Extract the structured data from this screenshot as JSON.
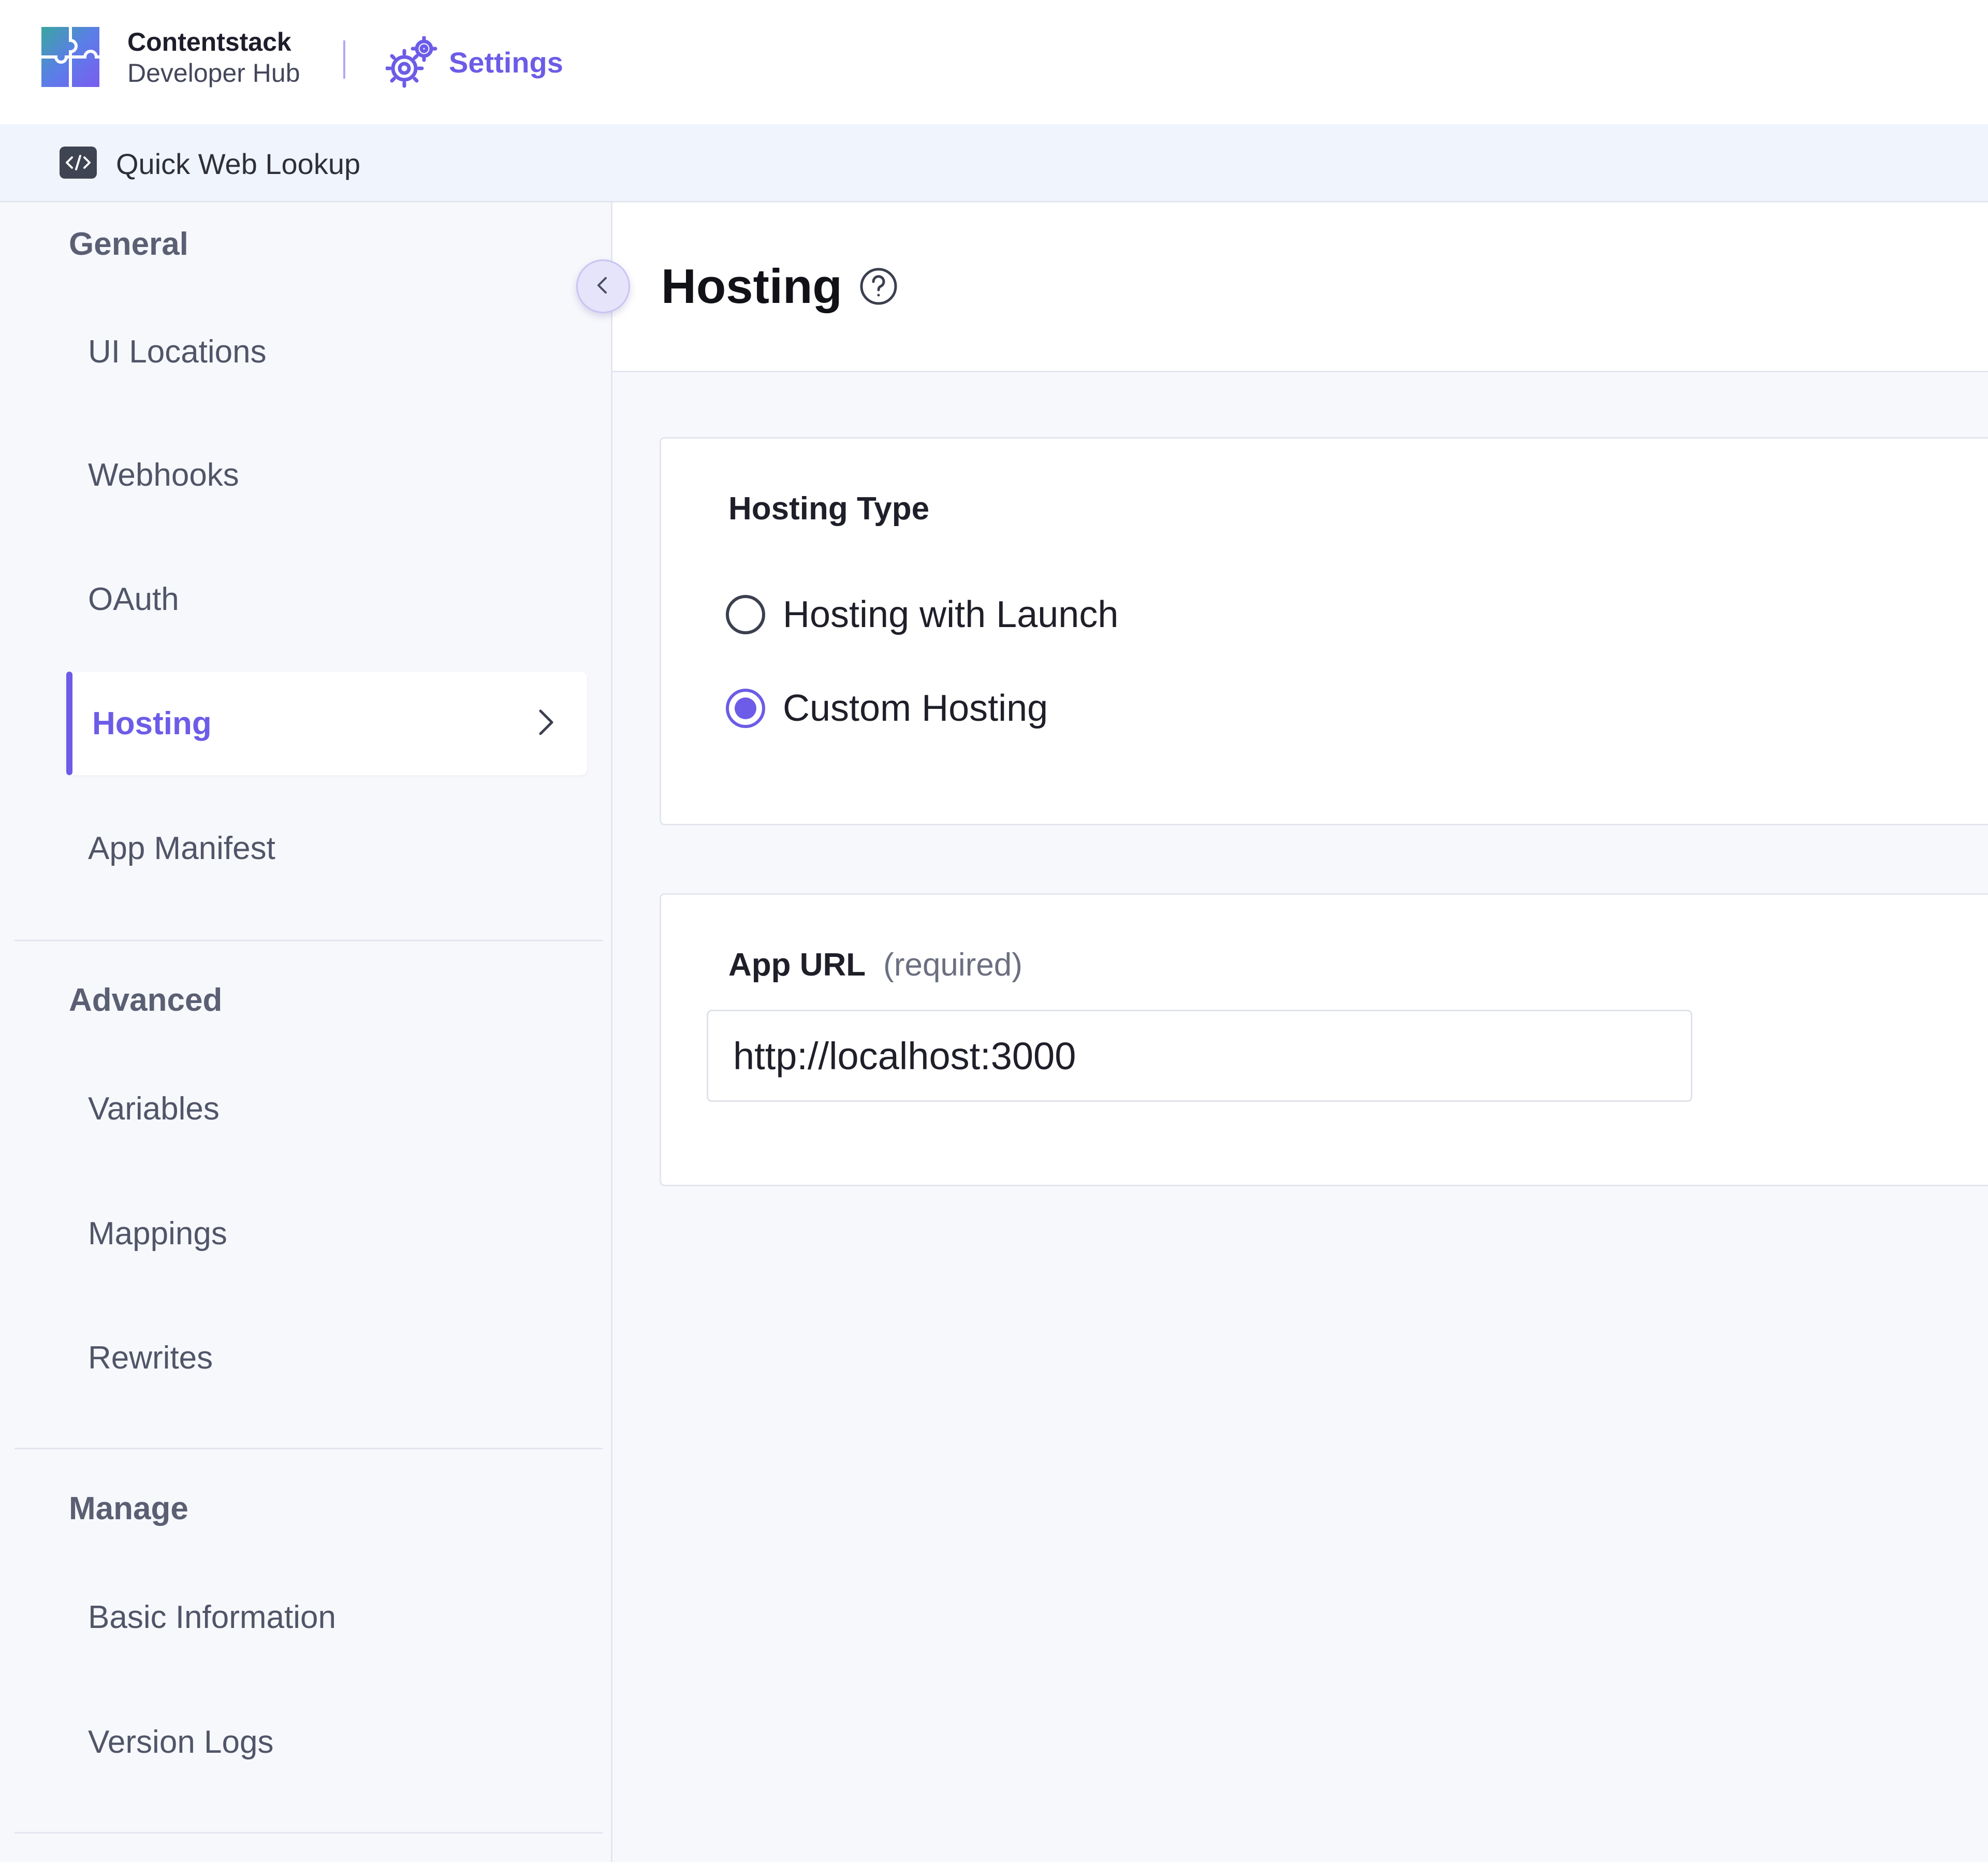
{
  "header": {
    "brand_name": "Contentstack",
    "brand_sub": "Developer Hub",
    "settings_label": "Settings"
  },
  "app": {
    "name": "Quick Web Lookup"
  },
  "sidebar": {
    "general_heading": "General",
    "general_items": [
      {
        "label": "UI Locations"
      },
      {
        "label": "Webhooks"
      },
      {
        "label": "OAuth"
      },
      {
        "label": "Hosting",
        "active": true
      },
      {
        "label": "App Manifest"
      }
    ],
    "advanced_heading": "Advanced",
    "advanced_items": [
      {
        "label": "Variables"
      },
      {
        "label": "Mappings"
      },
      {
        "label": "Rewrites"
      }
    ],
    "manage_heading": "Manage",
    "manage_items": [
      {
        "label": "Basic Information"
      },
      {
        "label": "Version Logs"
      }
    ]
  },
  "main": {
    "title": "Hosting",
    "hosting_type": {
      "title": "Hosting Type",
      "options": [
        {
          "label": "Hosting with Launch",
          "selected": false
        },
        {
          "label": "Custom Hosting",
          "selected": true
        }
      ]
    },
    "app_url": {
      "label": "App URL",
      "required_text": "(required)",
      "value": "http://localhost:3000"
    }
  },
  "colors": {
    "accent": "#6c5ce7",
    "sidebar_bg": "#f7f8fc",
    "appbar_bg": "#f0f4fd"
  },
  "icons": {
    "logo": "puzzle-logo-icon",
    "settings": "gears-icon",
    "app": "code-brackets-icon",
    "collapse": "chevron-left-icon",
    "active_nav": "chevron-right-icon",
    "help": "question-circle-icon"
  }
}
